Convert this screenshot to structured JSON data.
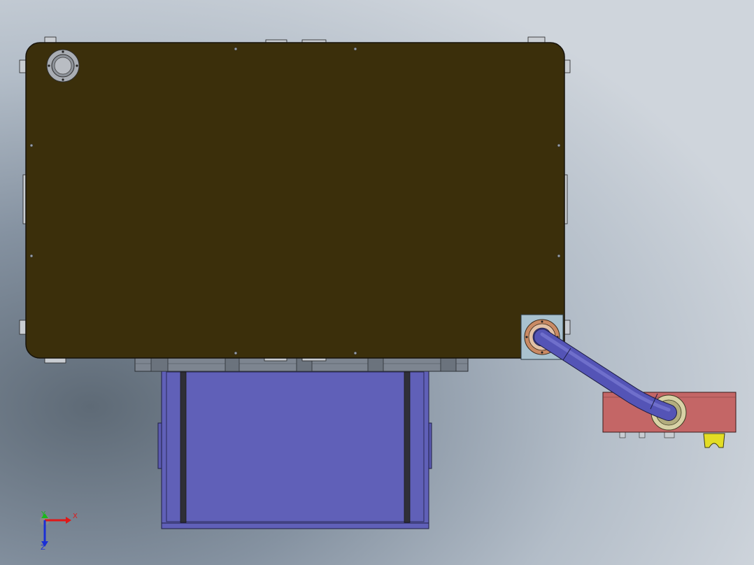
{
  "triad": {
    "x_label": "X",
    "y_label": "Y",
    "z_label": "Z",
    "x_color": "#e01818",
    "y_color": "#19b81c",
    "z_color": "#1a2fd6"
  },
  "colors": {
    "tank_lid": "#3b2f0b",
    "bin": "#6060b8",
    "pipe": "#5454b6",
    "motor_housing": "#c46666",
    "flange_plate": "#a9c2cf",
    "flange_ring": "#c98a64",
    "yellow_support": "#e3dd25"
  },
  "icons": {
    "port": "circular-port-icon",
    "fitting": "pipe-fitting-icon"
  }
}
